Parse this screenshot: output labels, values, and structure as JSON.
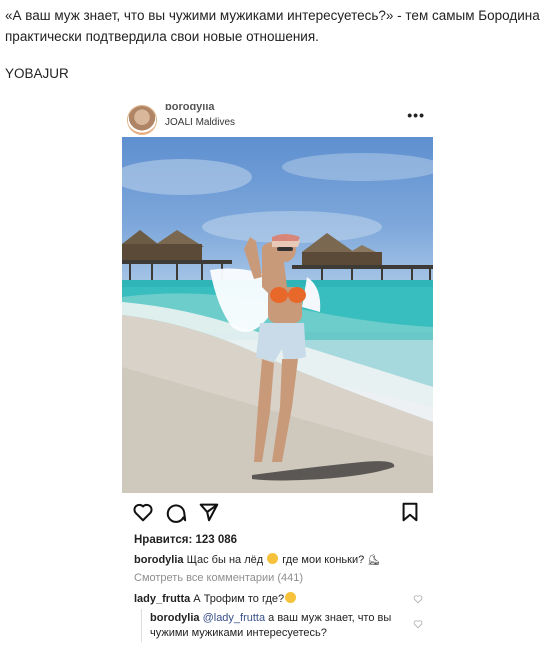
{
  "article": {
    "quote": "«А ваш муж знает, что вы чужими мужиками интересуетесь?» - тем самым Бородина практически подтвердила свои новые отношения.",
    "source": "YOBAJUR"
  },
  "post": {
    "username": "borodylia",
    "location": "JOALI Maldives",
    "more_icon": "more-dots-icon",
    "likes": "Нравится: 123 086",
    "caption": {
      "author": "borodylia",
      "text_before": " Щас бы на лёд ",
      "text_after": " где мои коньки? "
    },
    "view_all": "Смотреть все комментарии (441)",
    "comments": [
      {
        "author": "lady_frutta",
        "text": " А Трофим то где?"
      }
    ],
    "reply": {
      "author": "borodylia",
      "mention": "@lady_frutta",
      "text": " а ваш муж знает, что вы чужими мужиками интересуетесь?"
    },
    "icons": [
      "heart-icon",
      "comment-icon",
      "send-icon",
      "bookmark-icon"
    ]
  }
}
